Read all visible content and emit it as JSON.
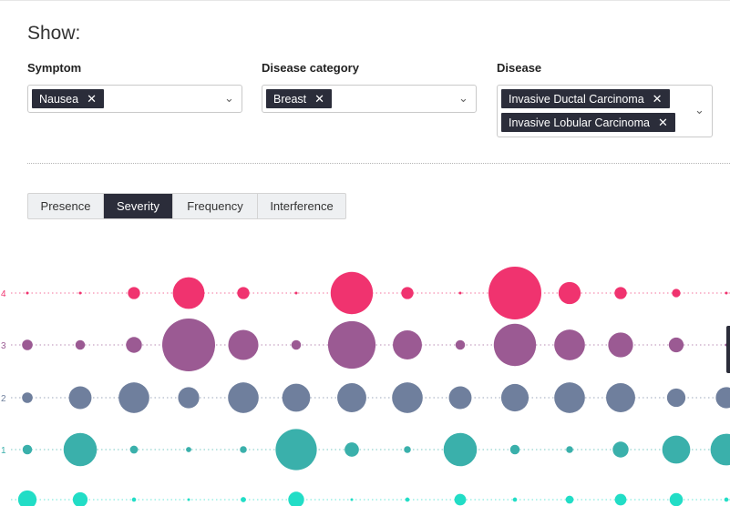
{
  "show_title": "Show:",
  "filters": {
    "symptom": {
      "label": "Symptom",
      "chips": [
        "Nausea"
      ]
    },
    "category": {
      "label": "Disease category",
      "chips": [
        "Breast"
      ]
    },
    "disease": {
      "label": "Disease",
      "chips": [
        "Invasive Ductal Carcinoma",
        "Invasive Lobular Carcinoma"
      ]
    }
  },
  "tabs": [
    {
      "label": "Presence",
      "active": false
    },
    {
      "label": "Severity",
      "active": true
    },
    {
      "label": "Frequency",
      "active": false
    },
    {
      "label": "Interference",
      "active": false
    }
  ],
  "icons": {
    "remove": "close-icon",
    "expand": "chevron-down-icon"
  },
  "chart_data": {
    "type": "scatter",
    "y_levels": [
      "0",
      "1",
      "2",
      "3",
      "4"
    ],
    "visible_tick_labels": [
      "1",
      "2",
      "3",
      "4"
    ],
    "x_count": 14,
    "series": [
      {
        "level": "4",
        "color": "#f0336f",
        "sizes": [
          0.05,
          0.05,
          0.23,
          0.6,
          0.23,
          0.05,
          0.8,
          0.23,
          0.05,
          1.0,
          0.42,
          0.23,
          0.16,
          0.05
        ]
      },
      {
        "level": "3",
        "color": "#9b5a93",
        "sizes": [
          0.2,
          0.18,
          0.3,
          1.0,
          0.57,
          0.18,
          0.9,
          0.55,
          0.18,
          0.8,
          0.58,
          0.47,
          0.28,
          0.05
        ]
      },
      {
        "level": "2",
        "color": "#6f7f9d",
        "sizes": [
          0.2,
          0.43,
          0.58,
          0.4,
          0.58,
          0.53,
          0.55,
          0.58,
          0.43,
          0.52,
          0.58,
          0.55,
          0.35,
          0.4
        ]
      },
      {
        "level": "1",
        "color": "#3ab0ab",
        "sizes": [
          0.18,
          0.63,
          0.15,
          0.1,
          0.13,
          0.78,
          0.27,
          0.13,
          0.63,
          0.18,
          0.13,
          0.3,
          0.53,
          0.6
        ]
      },
      {
        "level": "0",
        "color": "#22ddc6",
        "sizes": [
          0.35,
          0.28,
          0.08,
          0.05,
          0.1,
          0.3,
          0.05,
          0.08,
          0.22,
          0.08,
          0.15,
          0.22,
          0.25,
          0.08
        ]
      }
    ],
    "grid": "dotted horizontal"
  }
}
